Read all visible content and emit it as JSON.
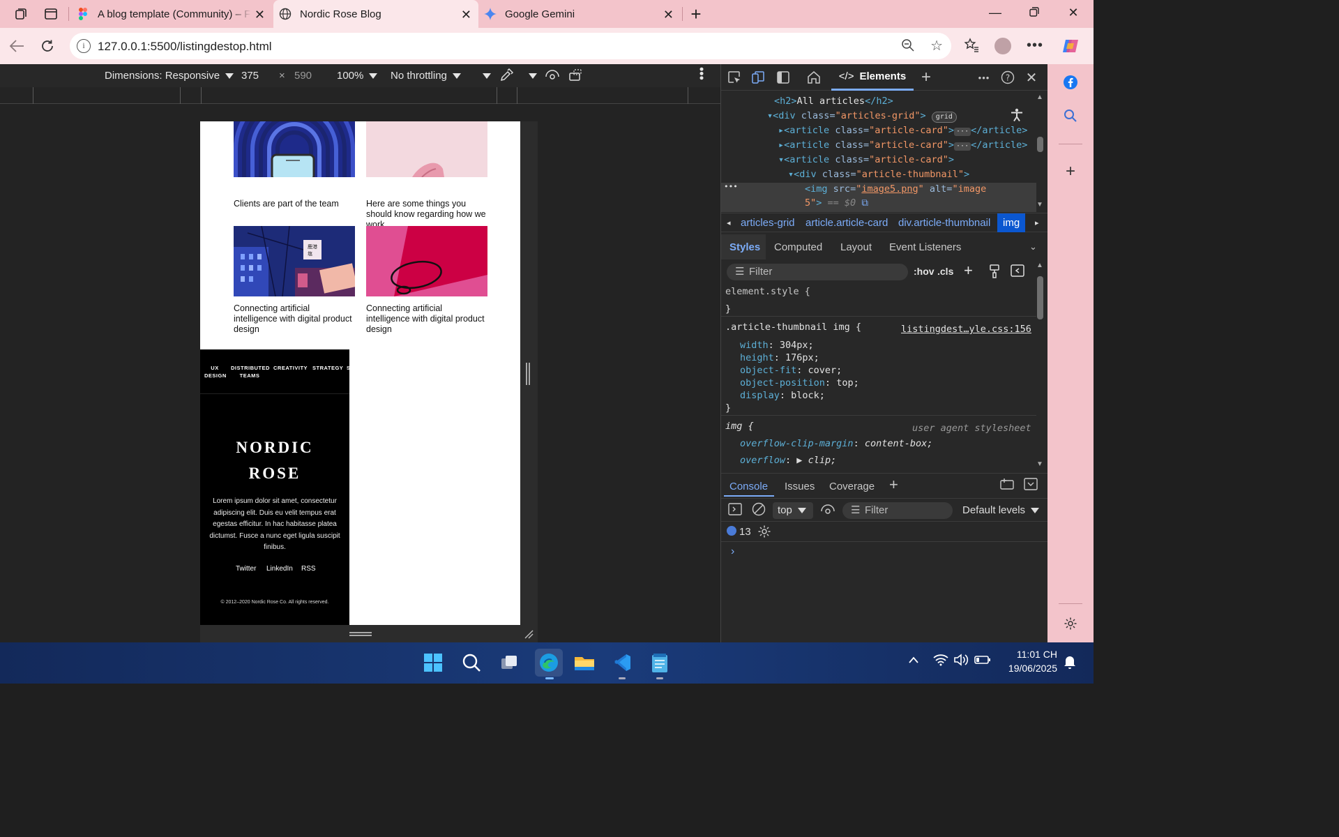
{
  "browser": {
    "tabs": [
      {
        "title": "A blog template (Community) – F",
        "icon": "figma-icon"
      },
      {
        "title": "Nordic Rose Blog",
        "icon": "globe-icon"
      },
      {
        "title": "Google Gemini",
        "icon": "gemini-icon"
      }
    ],
    "url": "127.0.0.1:5500/listingdestop.html"
  },
  "device_toolbar": {
    "dimensions": "Dimensions: Responsive",
    "width": "375",
    "times": "×",
    "height": "590",
    "zoom": "100%",
    "throttling": "No throttling"
  },
  "page": {
    "cards": [
      {
        "title": "Clients are part of the team"
      },
      {
        "title": "Here are some things you should know regarding how we work"
      },
      {
        "title": "Connecting artificial intelligence with digital product design"
      },
      {
        "title": "Connecting artificial intelligence with digital product design"
      }
    ],
    "footer": {
      "nav": [
        "UX\nDESIGN",
        "DISTRIBUTED\nTEAMS",
        "CREATIVITY",
        "STRATEGY",
        "S"
      ],
      "brand_line1": "NORDIC",
      "brand_line2": "ROSE",
      "description": "Lorem ipsum dolor sit amet, consectetur adipiscing elit. Duis eu velit tempus erat egestas efficitur. In hac habitasse platea dictumst. Fusce a nunc eget ligula suscipit finibus.",
      "links": [
        "Twitter",
        "LinkedIn",
        "RSS"
      ],
      "copyright": "© 2012–2020 Nordic Rose Co. All rights reserved."
    }
  },
  "devtools": {
    "main_tab": "Elements",
    "dom": {
      "h2_open": "<h2>",
      "h2_text": "All articles",
      "h2_close": "</h2>",
      "div_tag": "div",
      "attr_class": "class",
      "grid_class": "\"articles-grid\"",
      "grid_badge": "grid",
      "article_tag": "article",
      "article_class": "\"article-card\"",
      "article_close": "</article>",
      "thumb_class": "\"article-thumbnail\"",
      "img_tag": "img",
      "attr_src": "src",
      "src_value": "image5.png",
      "attr_alt": "alt",
      "alt_value_1": "\"image",
      "alt_value_2": "5\"",
      "dollar0": "== $0",
      "ellipsis": "•••"
    },
    "breadcrumbs": [
      "articles-grid",
      "article.article-card",
      "div.article-thumbnail",
      "img"
    ],
    "style_tabs": [
      "Styles",
      "Computed",
      "Layout",
      "Event Listeners"
    ],
    "styles_filter_placeholder": "Filter",
    "hov": ":hov",
    "cls": ".cls",
    "rules": {
      "element_style": "element.style {",
      "close_brace": "}",
      "thumb_selector": ".article-thumbnail img {",
      "thumb_source": "listingdest…yle.css:156",
      "thumb_props": [
        {
          "name": "width",
          "value": "304px;"
        },
        {
          "name": "height",
          "value": "176px;"
        },
        {
          "name": "object-fit",
          "value": "cover;"
        },
        {
          "name": "object-position",
          "value": "top;"
        },
        {
          "name": "display",
          "value": "block;"
        }
      ],
      "ua_selector": "img {",
      "ua_source": "user agent stylesheet",
      "ua_props": [
        {
          "name": "overflow-clip-margin",
          "value": "content-box;"
        },
        {
          "name": "overflow",
          "value": "clip;"
        }
      ]
    },
    "console_tabs": [
      "Console",
      "Issues",
      "Coverage"
    ],
    "context": "top",
    "console_filter_placeholder": "Filter",
    "levels": "Default levels",
    "message_count": "13"
  },
  "taskbar": {
    "time": "11:01 CH",
    "date": "19/06/2025"
  }
}
